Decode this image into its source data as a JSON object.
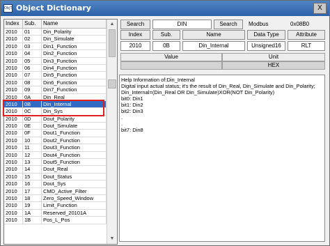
{
  "window": {
    "title": "Object Dictionary",
    "icon_text": "ObjT",
    "close_label": "X"
  },
  "list": {
    "columns": [
      "Index",
      "Sub.",
      "Name"
    ],
    "rows": [
      [
        "2010",
        "01",
        "Din_Polarity"
      ],
      [
        "2010",
        "02",
        "Din_Simulate"
      ],
      [
        "2010",
        "03",
        "Din1_Function"
      ],
      [
        "2010",
        "04",
        "Din2_Function"
      ],
      [
        "2010",
        "05",
        "Din3_Function"
      ],
      [
        "2010",
        "06",
        "Din4_Function"
      ],
      [
        "2010",
        "07",
        "Din5_Function"
      ],
      [
        "2010",
        "08",
        "Din6_Function"
      ],
      [
        "2010",
        "09",
        "Din7_Function"
      ],
      [
        "2010",
        "0A",
        "Din_Real"
      ],
      [
        "2010",
        "0B",
        "Din_Internal"
      ],
      [
        "2010",
        "0C",
        "Din_Sys"
      ],
      [
        "2010",
        "0D",
        "Dout_Polarity"
      ],
      [
        "2010",
        "0E",
        "Dout_Simulate"
      ],
      [
        "2010",
        "0F",
        "Dout1_Function"
      ],
      [
        "2010",
        "10",
        "Dout2_Function"
      ],
      [
        "2010",
        "11",
        "Dout3_Function"
      ],
      [
        "2010",
        "12",
        "Dout4_Function"
      ],
      [
        "2010",
        "13",
        "Dout5_Function"
      ],
      [
        "2010",
        "14",
        "Dout_Real"
      ],
      [
        "2010",
        "15",
        "Dout_Status"
      ],
      [
        "2010",
        "16",
        "Dout_Sys"
      ],
      [
        "2010",
        "17",
        "CMD_Active_Filter"
      ],
      [
        "2010",
        "18",
        "Zero_Speed_Window"
      ],
      [
        "2010",
        "19",
        "Limit_Function"
      ],
      [
        "2010",
        "1A",
        "Reserved_20101A"
      ],
      [
        "2010",
        "1B",
        "Pos_L_Pos"
      ]
    ],
    "selected_index": 10
  },
  "search": {
    "label": "Search",
    "value": "DIN",
    "button": "Search",
    "modbus_label": "Modbus",
    "modbus_value": "0x08B0"
  },
  "headers": {
    "index": "Index",
    "sub": "Sub.",
    "name": "Name",
    "data_type": "Data Type",
    "attribute": "Attribute"
  },
  "selected": {
    "index": "2010",
    "sub": "0B",
    "name": "Din_Internal",
    "data_type": "Unsigned16",
    "attribute": "RLT"
  },
  "value_table": {
    "value_header": "Value",
    "unit_header": "Unit",
    "value": "",
    "unit": "HEX"
  },
  "help": {
    "lines": [
      "Help Information of:Din_Internal",
      "Digital input actual status; it's the result of Din_Real, Din_Simulate and Din_Polarity;",
      "Din_Internal=(Din_Real OR Din_Simulate)XOR(NOT Din_Polarity)",
      "bit0: Din1",
      "bit1: Din2",
      "bit2: Din3",
      ".",
      ".",
      "bit7: Din8"
    ]
  },
  "colors": {
    "titlebar": "#2e62a8",
    "selection": "#316ac5",
    "highlight": "#e02020"
  }
}
